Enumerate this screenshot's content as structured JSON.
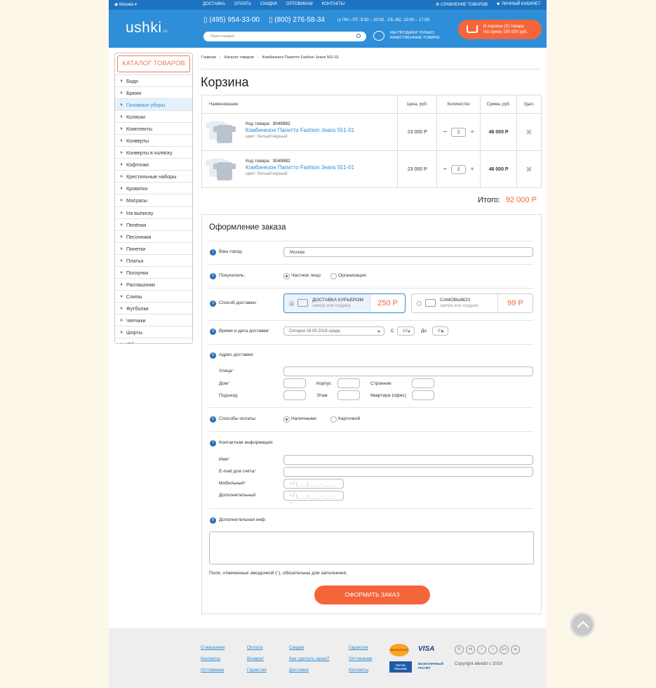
{
  "topbar": {
    "city": "Москва",
    "nav": [
      "ДОСТАВКА",
      "ОПЛАТА",
      "СКИДКИ",
      "ОПТОВИКАМ",
      "КОНТАКТЫ"
    ],
    "compare": "СРАВНЕНИЕ ТОВАРОВ",
    "account": "ЛИЧНЫЙ КАБИНЕТ"
  },
  "header": {
    "logo": "ushki",
    "logo_suffix": ".ru",
    "phone1": "(495) 954-33-00",
    "phone2": "(800) 276-58-34",
    "hours": "ПН—ПТ: 9:30 – 20:00 , СБ–ВС: 10:00 – 17:00",
    "search_placeholder": "Поиск товаров",
    "quality_line1": "МЫ ПРОДАЁМ ТОЛЬКО",
    "quality_line2": "КАЧЕСТВЕННЫЕ ТОВАРЫ",
    "cart_line1": "В корзине (3) товара",
    "cart_line2": "На сумму 150 000 руб."
  },
  "sidebar": {
    "title": "КАТАЛОГ ТОВАРОВ",
    "items": [
      "Боди",
      "Брюки",
      "Головные уборы",
      "Коляски",
      "Комплекты",
      "Конверты",
      "Конверты в коляску",
      "Кофточки",
      "Крестильные наборы",
      "Кроватки",
      "Матрасы",
      "На выписку",
      "Пелёнки",
      "Песочники",
      "Пинетки",
      "Платья",
      "Ползунки",
      "Распашонки",
      "Слипы",
      "Футболки",
      "Чепчики",
      "Шорты",
      "Юбки"
    ],
    "active_index": 2
  },
  "breadcrumb": [
    "Главная",
    "Каталог товаров",
    "Комбинезон Папитто Fashion Jeans 551-01"
  ],
  "page_title": "Корзина",
  "cart_table": {
    "headers": [
      "Наименование",
      "Цена, руб.",
      "Количество",
      "Сумма, руб.",
      "Удал."
    ],
    "rows": [
      {
        "code_label": "Код товара:",
        "code": "3049982",
        "name": "Комбинезон Папитто Fashion Jeans 551-01",
        "color": "цвет: белый/черный",
        "price": "23 000 Р",
        "qty": "2",
        "sum": "46 000 Р"
      },
      {
        "code_label": "Код товара:",
        "code": "3049982",
        "name": "Комбинезон Папитто Fashion Jeans 551-01",
        "color": "цвет: белый/черный",
        "price": "23 000 Р",
        "qty": "2",
        "sum": "46 000 Р"
      }
    ],
    "total_label": "Итого:",
    "total_value": "92 000 Р"
  },
  "order": {
    "title": "Оформление заказа",
    "city_label": "Ваш город:",
    "city_value": "Москва",
    "buyer_label": "Покупатель:",
    "buyer_opt1": "Частное лицо",
    "buyer_opt2": "Организация",
    "delivery_label": "Способ доставки:",
    "courier_title": "ДОСТАВКА КУРЬЕРОМ",
    "courier_sub": "завтра или позднее",
    "courier_price": "250 Р",
    "pickup_title": "САМОВЫВОЗ",
    "pickup_sub": "завтра или позднее",
    "pickup_price": "99 Р",
    "time_label": "Время и дата доставки:",
    "date_value": "Сегодня 16.05.2018  среда",
    "from_label": "С",
    "from_value": "10",
    "to_label": "До",
    "to_value": "01",
    "address_label": "Адрес доставки:",
    "street": "Улица",
    "house": "Дом",
    "korpus": "Корпус",
    "stroenie": "Строение",
    "podezd": "Подъезд",
    "etazh": "Этаж",
    "kvartira": "Квартира (офис)",
    "payment_label": "Способы оплаты:",
    "pay_opt1": "Наличными",
    "pay_opt2": "Карточкой",
    "contact_label": "Контактная информация:",
    "name_label": "Имя",
    "email_label": "E-mail для счёта",
    "mobile_label": "Мобильный",
    "extra_phone_label": "Дополнительный",
    "phone_placeholder": "+7 (_ _ _) _ _ _ - _ _ - _ _",
    "extra_info_label": "Дополнительная инф:",
    "required_note_a": "Поля, отмеченные звездочкой (",
    "required_star": "*",
    "required_note_b": "), обязательны для заполнения.",
    "submit": "ОФОРМИТЬ ЗАКАЗ",
    "steps": [
      "1",
      "2",
      "3",
      "4",
      "5",
      "6",
      "7",
      "8"
    ]
  },
  "footer": {
    "col1": [
      "О магазине",
      "Контакты",
      "Оптовикам"
    ],
    "col2": [
      "Оплата",
      "Возврат",
      "Гарантия"
    ],
    "col3": [
      "Скидки",
      "Как сделать заказ?",
      "Доставка"
    ],
    "col4": [
      "Гарантия",
      "Оптовикам",
      "Контакты"
    ],
    "pay_mc": "MasterCard",
    "pay_visa": "VISA",
    "pay_post": "ПОЧТА РОССИИ",
    "pay_cash": "БЕЗНАЛИЧНЫЙ РАСЧЁТ",
    "social": [
      "B",
      "vk",
      "f",
      "t",
      "G+",
      "ig"
    ],
    "copyright": "Copyright alexdiz  c  2018"
  },
  "colors": {
    "primary": "#2e8ed8",
    "accent": "#f5653a",
    "link": "#2d8cd6"
  }
}
